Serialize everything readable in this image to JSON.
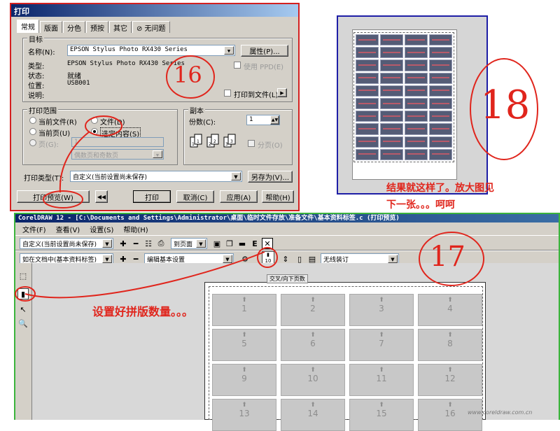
{
  "print_dialog": {
    "title": "打印",
    "tabs": [
      "常规",
      "版面",
      "分色",
      "预按",
      "其它",
      "⊘ 无问题"
    ],
    "target": {
      "group_title": "目标",
      "name_label": "名称(N):",
      "name_value": "EPSON Stylus Photo RX430 Series",
      "properties_button": "属性(P)...",
      "type_label": "类型:",
      "type_value": "EPSON Stylus Photo RX430 Series",
      "status_label": "状态:",
      "status_value": "就绪",
      "location_label": "位置:",
      "location_value": "USB001",
      "comment_label": "说明:",
      "use_ppd_label": "使用 PPD(E)",
      "print_to_file_label": "打印到文件(L)"
    },
    "range": {
      "group_title": "打印范围",
      "current_document": "当前文件(R)",
      "document": "文件(D)",
      "current_page": "当前页(U)",
      "selection": "选定内容(S)",
      "pages": "页(G):",
      "pages_value": "1",
      "page_set": "偶数页和奇数页"
    },
    "copies": {
      "group_title": "副本",
      "count_label": "份数(C):",
      "count_value": "1",
      "collate_label": "分页(O)",
      "collate_icons": [
        "1",
        "1",
        "2",
        "2",
        "3",
        "3"
      ]
    },
    "print_style_label": "打印类型(T):",
    "print_style_value": "自定义(当前设置尚未保存)",
    "save_as_button": "另存为(V)...",
    "buttons": {
      "print_preview": "打印预览(W)",
      "print": "打印",
      "cancel": "取消(C)",
      "apply": "应用(A)",
      "help": "帮助(H)"
    }
  },
  "annotations": {
    "a16": "16",
    "a18": "18",
    "a17": "17",
    "result_line1": "结果就这样了。放大图见",
    "result_line2": "下一张。。。呵呵",
    "set_layout": "设置好拼版数量。。。"
  },
  "corel": {
    "title": "CorelDRAW 12 - [C:\\Documents and Settings\\Administrator\\桌面\\临时文件存放\\准备文件\\基本资料标签.c (打印预览)",
    "menu": [
      "文件(F)",
      "查看(V)",
      "设置(S)",
      "帮助(H)"
    ],
    "toolbar1": {
      "preset": "自定义(当前设置尚未保存)",
      "page_mode": "到页面"
    },
    "toolbar2": {
      "position": "如在文档中(基本资料标签)",
      "layout": "编辑基本设置",
      "layout_count": "10",
      "binding": "无线装订"
    },
    "page_tooltip": "交叉/向下页数",
    "cells": [
      "1",
      "2",
      "3",
      "4",
      "5",
      "6",
      "7",
      "8",
      "9",
      "10",
      "11",
      "12",
      "13",
      "14",
      "15",
      "16"
    ],
    "watermark": "www.coreldraw.com.cn"
  },
  "preview": {
    "rows": 10,
    "cols": 4
  },
  "colors": {
    "annotation_red": "#e0251c",
    "dialog_border": "#d42020",
    "preview_border": "#1e1ea6",
    "corel_border": "#3cb43c"
  }
}
